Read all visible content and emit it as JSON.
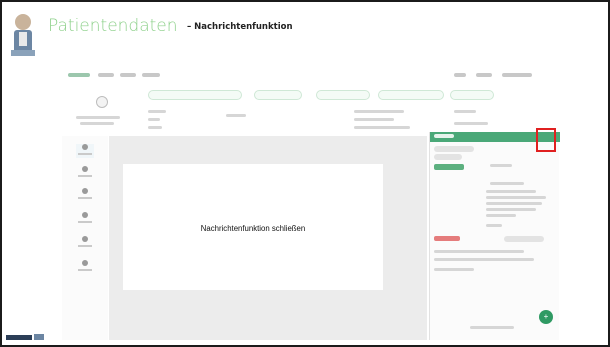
{
  "slide": {
    "title": "Patientendaten",
    "title_separator": "–",
    "subtitle": "Nachrichtenfunktion"
  },
  "modal": {
    "message": "Nachrichtenfunktion schließen"
  },
  "colors": {
    "title_green": "#8fd18c",
    "panel_green": "#4aa878",
    "highlight_red": "#e02020",
    "overlay_grey": "#ececec"
  },
  "icons": {
    "fab": "plus-icon"
  }
}
